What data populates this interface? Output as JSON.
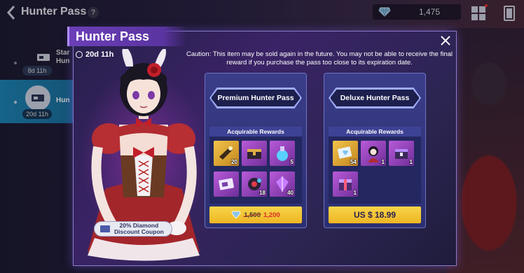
{
  "topbar": {
    "title": "Hunter Pass",
    "help": "?",
    "currency_amount": "1,475"
  },
  "sidebar": {
    "items": [
      {
        "label": "Star\nHun",
        "days": "8d 11h"
      },
      {
        "label": "Hun",
        "days": "20d 11h"
      }
    ]
  },
  "modal": {
    "title": "Hunter Pass",
    "timer": "20d 11h",
    "caution": "Caution: This item may be sold again in the future. You may not be able to receive the final reward if you purchase the pass too close to its expiration date.",
    "coupon": {
      "line1": "20% Diamond",
      "line2": "Discount Coupon"
    }
  },
  "premium": {
    "name": "Premium Hunter Pass",
    "rewards_label": "Acquirable Rewards",
    "rewards": [
      {
        "icon": "gold-weapon-icon",
        "qty": "20",
        "tier": "gold"
      },
      {
        "icon": "chest-icon",
        "qty": "",
        "tier": "purple"
      },
      {
        "icon": "potion-icon",
        "qty": "5",
        "tier": "purple"
      },
      {
        "icon": "ticket-icon",
        "qty": "",
        "tier": "purple"
      },
      {
        "icon": "gear-part-icon",
        "qty": "18",
        "tier": "purple"
      },
      {
        "icon": "crystal-icon",
        "qty": "40",
        "tier": "purple"
      }
    ],
    "price_gems": "1,500",
    "price_discount": "1,200"
  },
  "deluxe": {
    "name": "Deluxe Hunter Pass",
    "rewards_label": "Acquirable Rewards",
    "rewards": [
      {
        "icon": "diamond-card-icon",
        "qty": "54",
        "tier": "gold"
      },
      {
        "icon": "character-portrait-icon",
        "qty": "1",
        "tier": "purple"
      },
      {
        "icon": "supply-box-icon",
        "qty": "1",
        "tier": "purple"
      },
      {
        "icon": "gift-box-icon",
        "qty": "1",
        "tier": "purple"
      }
    ],
    "price": "US $ 18.99"
  },
  "colors": {
    "accent": "#6b3fb8",
    "card": "#3a3d88",
    "button": "#f2c235",
    "sidebar_active": "#1f86b8"
  }
}
